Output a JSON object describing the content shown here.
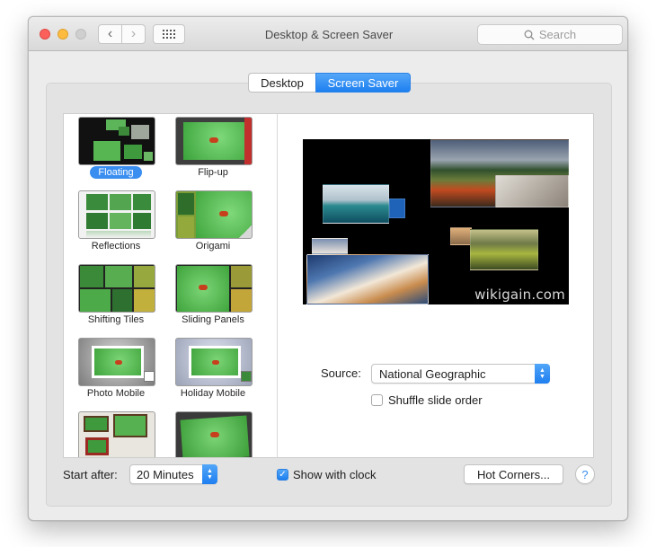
{
  "window": {
    "title": "Desktop & Screen Saver"
  },
  "toolbar": {
    "back_glyph": "‹",
    "forward_glyph": "›",
    "search_placeholder": "Search"
  },
  "tabs": [
    {
      "label": "Desktop",
      "selected": false
    },
    {
      "label": "Screen Saver",
      "selected": true
    }
  ],
  "savers": [
    {
      "label": "Floating",
      "selected": true
    },
    {
      "label": "Flip-up",
      "selected": false
    },
    {
      "label": "Reflections",
      "selected": false
    },
    {
      "label": "Origami",
      "selected": false
    },
    {
      "label": "Shifting Tiles",
      "selected": false
    },
    {
      "label": "Sliding Panels",
      "selected": false
    },
    {
      "label": "Photo Mobile",
      "selected": false
    },
    {
      "label": "Holiday Mobile",
      "selected": false
    }
  ],
  "preview": {
    "watermark": "wikigain.com"
  },
  "source": {
    "label": "Source:",
    "value": "National Geographic"
  },
  "shuffle": {
    "label": "Shuffle slide order",
    "checked": false
  },
  "start_after": {
    "label": "Start after:",
    "value": "20 Minutes"
  },
  "show_clock": {
    "label": "Show with clock",
    "checked": true
  },
  "hot_corners": {
    "label": "Hot Corners..."
  },
  "help": {
    "label": "?"
  },
  "colors": {
    "accent": "#1d7ff0",
    "close": "#fc605b",
    "minimize": "#fdbc40",
    "zoom": "#cfcfcf"
  }
}
